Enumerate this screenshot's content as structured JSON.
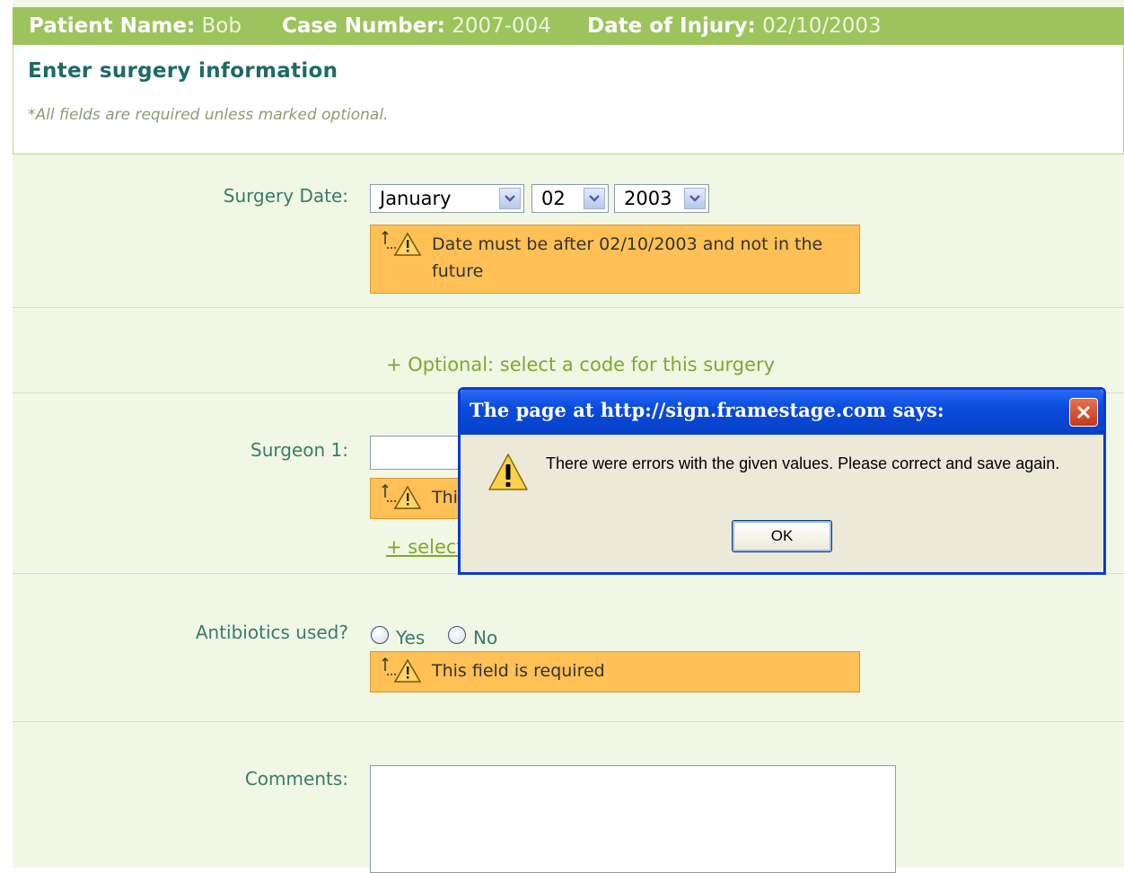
{
  "header": {
    "patient_label": "Patient Name:",
    "patient_value": "Bob",
    "case_label": "Case Number:",
    "case_value": "2007-004",
    "injury_label": "Date of Injury:",
    "injury_value": "02/10/2003"
  },
  "form": {
    "title": "Enter surgery information",
    "note": "*All fields are required unless marked optional.",
    "surgery_date": {
      "label": "Surgery Date:",
      "month": "January",
      "day": "02",
      "year": "2003",
      "error": "Date must be after 02/10/2003 and not in the future"
    },
    "code_link": "+ Optional: select a code for this surgery",
    "surgeon": {
      "label": "Surgeon 1:",
      "value": "",
      "error_partial": "Thi",
      "link_partial": "+ select"
    },
    "antibiotics": {
      "label": "Antibiotics used?",
      "yes": "Yes",
      "no": "No",
      "error": "This field is required"
    },
    "comments": {
      "label": "Comments:",
      "value": ""
    }
  },
  "dialog": {
    "title": "The page at http://sign.framestage.com says:",
    "message": "There were errors with the given values.  Please correct and save again.",
    "ok_label": "OK"
  },
  "colors": {
    "header_bg": "#9dc35d",
    "error_bg": "#ffc056",
    "dialog_titlebar": "#0b4bdc",
    "label_text": "#3a7a6b"
  },
  "icons": {
    "error": "warning-triangle-icon",
    "dialog": "exclamation-icon",
    "close": "close-x-icon",
    "dropdown": "chevron-down-icon"
  }
}
